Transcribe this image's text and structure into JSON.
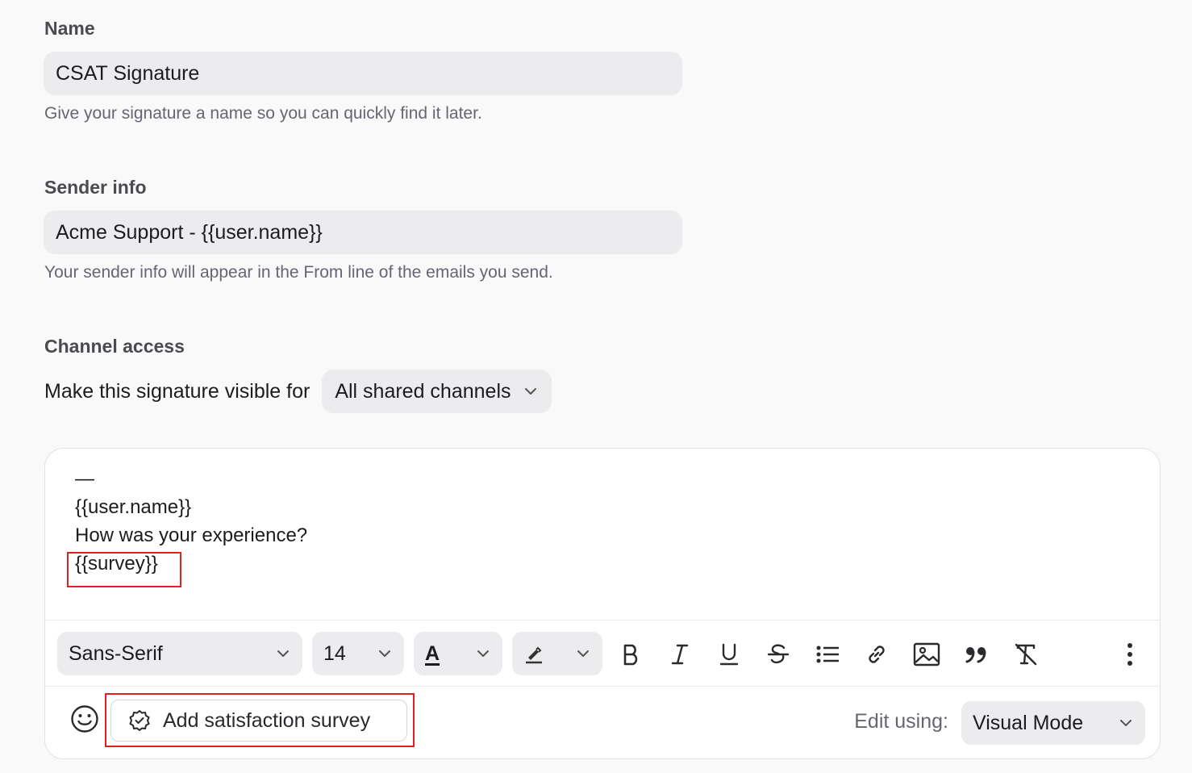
{
  "name_section": {
    "label": "Name",
    "value": "CSAT Signature",
    "helper": "Give your signature a name so you can quickly find it later."
  },
  "sender_section": {
    "label": "Sender info",
    "value": "Acme Support - {{user.name}}",
    "helper": "Your sender info will appear in the From line of the emails you send."
  },
  "channel_section": {
    "label": "Channel access",
    "visible_text": "Make this signature visible for",
    "selected": "All shared channels"
  },
  "editor": {
    "lines": [
      "—",
      "{{user.name}}",
      "How was your experience?",
      "{{survey}}"
    ],
    "highlight_color": "#e02020"
  },
  "toolbar": {
    "font_family": "Sans-Serif",
    "font_size": "14",
    "text_color_glyph": "A",
    "buttons": [
      "bold-icon",
      "italic-icon",
      "underline-icon",
      "strikethrough-icon",
      "bullet-list-icon",
      "link-icon",
      "image-icon",
      "quote-icon",
      "clear-format-icon",
      "more-vertical-icon"
    ]
  },
  "footer": {
    "survey_button": "Add satisfaction survey",
    "edit_label": "Edit using:",
    "mode": "Visual Mode"
  }
}
